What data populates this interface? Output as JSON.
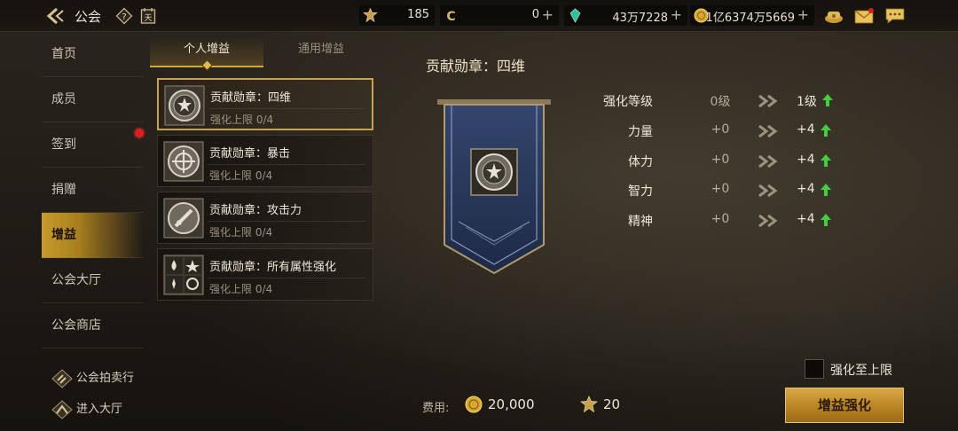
{
  "header": {
    "title": "公会",
    "back_icon": "back-arrow-icon",
    "help_icon": "help-icon",
    "calendar_icon": "calendar-icon",
    "calendar_glyph": "天",
    "resources": [
      {
        "icon": "medal-icon",
        "value": "185",
        "has_plus": false
      },
      {
        "icon": "currency-c-icon",
        "value": "0",
        "has_plus": true
      },
      {
        "icon": "gem-icon",
        "value": "43万7228",
        "has_plus": true
      },
      {
        "icon": "gold-coin-icon",
        "value": "1亿6374万5669",
        "has_plus": true
      }
    ],
    "plus": "+",
    "right_icons": [
      "treasure-chest-icon",
      "mail-icon",
      "chat-icon"
    ]
  },
  "sidebar": {
    "items": [
      {
        "label": "首页",
        "active": false
      },
      {
        "label": "成员",
        "active": false
      },
      {
        "label": "签到",
        "active": false,
        "badge": true
      },
      {
        "label": "捐赠",
        "active": false
      },
      {
        "label": "增益",
        "active": true
      },
      {
        "label": "公会大厅",
        "active": false
      },
      {
        "label": "公会商店",
        "active": false
      }
    ],
    "bottom": [
      {
        "label": "公会拍卖行",
        "icon": "auction-icon"
      },
      {
        "label": "进入大厅",
        "icon": "enter-hall-icon"
      }
    ]
  },
  "tabs": [
    {
      "label": "个人增益",
      "active": true
    },
    {
      "label": "通用增益",
      "active": false
    }
  ],
  "buff_list": [
    {
      "name": "贡献勋章：四维",
      "limit": "强化上限 0/4",
      "icon": "four-stats-medal-icon",
      "selected": true
    },
    {
      "name": "贡献勋章：暴击",
      "limit": "强化上限 0/4",
      "icon": "crit-medal-icon",
      "selected": false
    },
    {
      "name": "贡献勋章：攻击力",
      "limit": "强化上限 0/4",
      "icon": "attack-medal-icon",
      "selected": false
    },
    {
      "name": "贡献勋章：所有属性强化",
      "limit": "强化上限 0/4",
      "icon": "all-element-icon",
      "selected": false
    }
  ],
  "detail": {
    "title": "贡献勋章：四维",
    "stats": [
      {
        "label": "强化等级",
        "current": "0级",
        "next": "1级"
      },
      {
        "label": "力量",
        "current": "+0",
        "next": "+4"
      },
      {
        "label": "体力",
        "current": "+0",
        "next": "+4"
      },
      {
        "label": "智力",
        "current": "+0",
        "next": "+4"
      },
      {
        "label": "精神",
        "current": "+0",
        "next": "+4"
      }
    ],
    "max_checkbox_label": "强化至上限",
    "max_checked": false,
    "cost_label": "费用:",
    "cost_gold": "20,000",
    "cost_medal": "20",
    "action_label": "增益强化"
  },
  "colors": {
    "accent_gold": "#d3a83a",
    "up_green": "#3fcf3f",
    "badge_red": "#e01c1c"
  }
}
